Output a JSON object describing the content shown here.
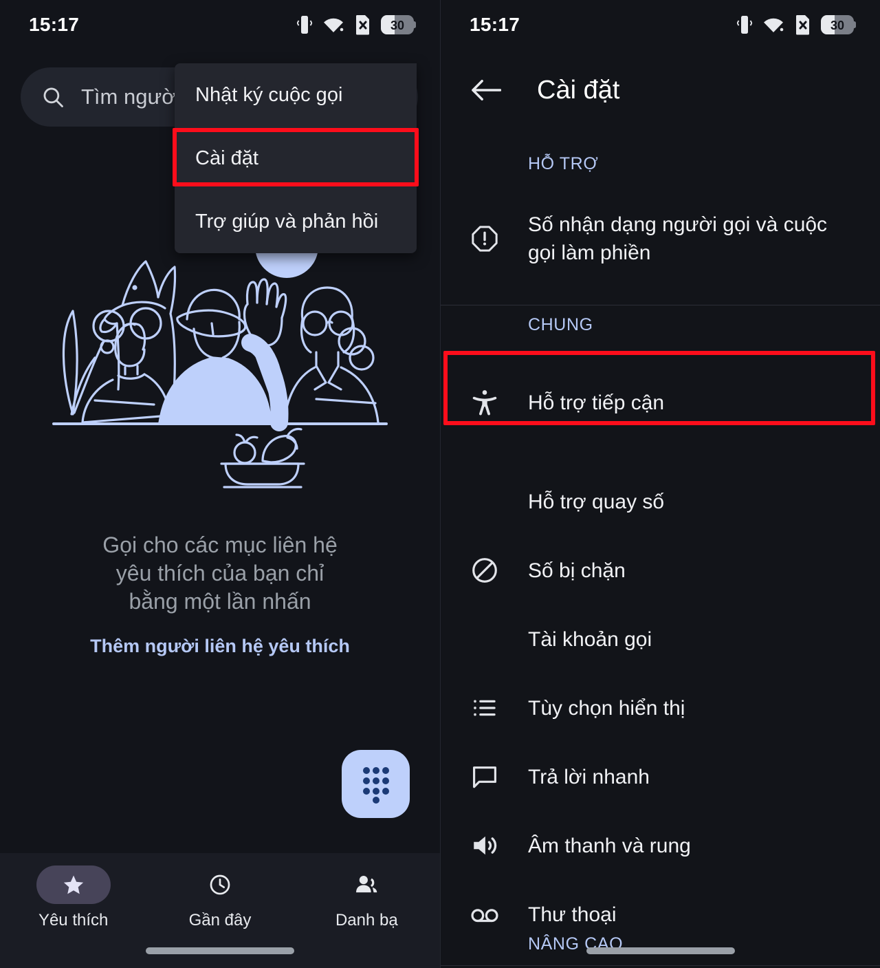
{
  "status_bar": {
    "time": "15:17",
    "battery_level": "30",
    "icons": [
      "vibrate-icon",
      "wifi-icon",
      "sim-error-icon",
      "battery-icon"
    ]
  },
  "colors": {
    "page_bg": "#12141a",
    "menu_bg": "#24262e",
    "accent_blue": "#b5c8f5",
    "highlight_red": "#fd0d1b",
    "fab_bg": "#bed0fb",
    "active_pill": "#474459"
  },
  "left_screen": {
    "search": {
      "placeholder": "Tìm người",
      "icon": "search-icon"
    },
    "overflow_menu": {
      "items": [
        {
          "label": "Nhật ký cuộc gọi",
          "highlighted": false
        },
        {
          "label": "Cài đặt",
          "highlighted": true
        },
        {
          "label": "Trợ giúp và phản hồi",
          "highlighted": false
        }
      ]
    },
    "empty_state": {
      "line1": "Gọi cho các mục liên hệ",
      "line2": "yêu thích của bạn chỉ",
      "line3": "bằng một lần nhấn",
      "link": "Thêm người liên hệ yêu thích",
      "illustration": "family-and-dog-at-table-illustration"
    },
    "fab": {
      "icon": "dialpad-icon"
    },
    "bottom_nav": [
      {
        "label": "Yêu thích",
        "icon": "star-icon",
        "active": true
      },
      {
        "label": "Gần đây",
        "icon": "clock-icon",
        "active": false
      },
      {
        "label": "Danh bạ",
        "icon": "contacts-icon",
        "active": false
      }
    ]
  },
  "right_screen": {
    "header": {
      "title": "Cài đặt",
      "back_icon": "arrow-left-icon"
    },
    "sections": [
      {
        "label": "HỖ TRỢ",
        "items": [
          {
            "label": "Số nhận dạng người gọi và cuộc gọi làm phiền",
            "icon": "alert-octagon-icon",
            "highlighted": false
          }
        ]
      },
      {
        "label": "CHUNG",
        "items": [
          {
            "label": "Hỗ trợ tiếp cận",
            "icon": "accessibility-icon",
            "highlighted": true
          },
          {
            "label": "Hỗ trợ quay số",
            "icon": "none",
            "highlighted": false
          },
          {
            "label": "Số bị chặn",
            "icon": "block-icon",
            "highlighted": false
          },
          {
            "label": "Tài khoản gọi",
            "icon": "none",
            "highlighted": false
          },
          {
            "label": "Tùy chọn hiển thị",
            "icon": "list-icon",
            "highlighted": false
          },
          {
            "label": "Trả lời nhanh",
            "icon": "chat-bubble-icon",
            "highlighted": false
          },
          {
            "label": "Âm thanh và rung",
            "icon": "volume-icon",
            "highlighted": false
          },
          {
            "label": "Thư thoại",
            "icon": "voicemail-icon",
            "highlighted": false
          }
        ]
      },
      {
        "label": "NÂNG CAO",
        "items": []
      }
    ]
  }
}
